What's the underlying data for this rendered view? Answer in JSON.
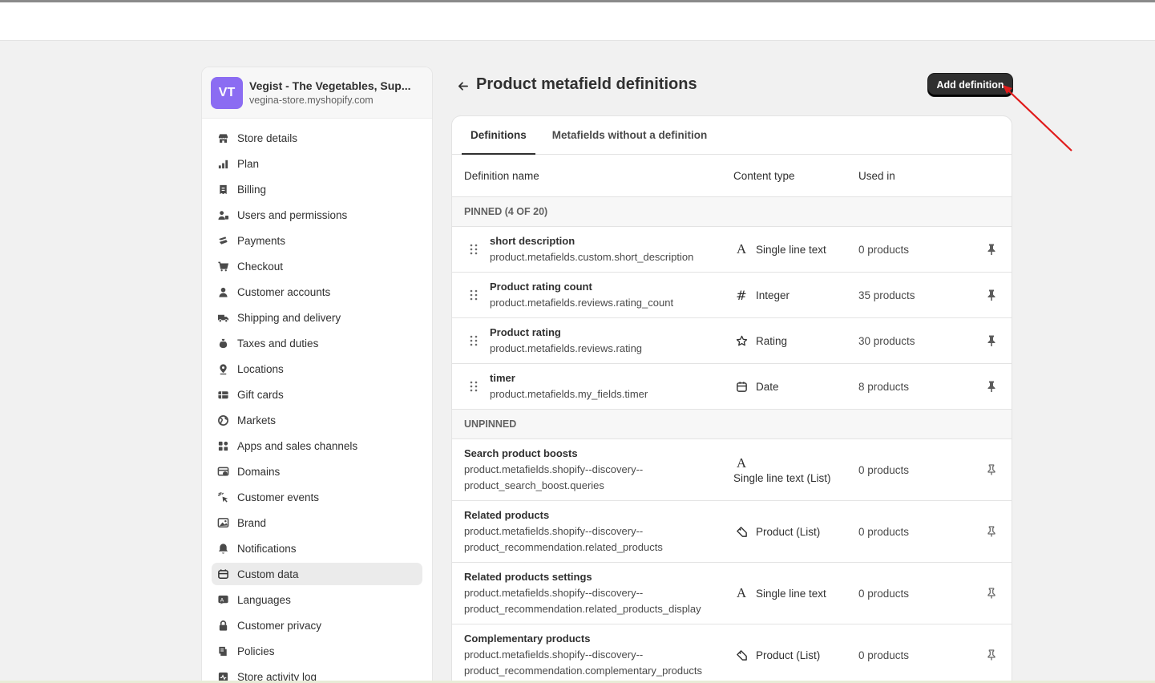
{
  "store": {
    "initials": "VT",
    "name": "Vegist - The Vegetables, Sup...",
    "domain": "vegina-store.myshopify.com"
  },
  "sidebar": {
    "items": [
      {
        "label": "Store details",
        "icon": "store-icon"
      },
      {
        "label": "Plan",
        "icon": "plan-icon"
      },
      {
        "label": "Billing",
        "icon": "billing-icon"
      },
      {
        "label": "Users and permissions",
        "icon": "users-icon"
      },
      {
        "label": "Payments",
        "icon": "payments-icon"
      },
      {
        "label": "Checkout",
        "icon": "cart-icon"
      },
      {
        "label": "Customer accounts",
        "icon": "person-icon"
      },
      {
        "label": "Shipping and delivery",
        "icon": "truck-icon"
      },
      {
        "label": "Taxes and duties",
        "icon": "tax-icon"
      },
      {
        "label": "Locations",
        "icon": "location-icon"
      },
      {
        "label": "Gift cards",
        "icon": "gift-card-icon"
      },
      {
        "label": "Markets",
        "icon": "globe-icon"
      },
      {
        "label": "Apps and sales channels",
        "icon": "apps-icon"
      },
      {
        "label": "Domains",
        "icon": "domain-icon"
      },
      {
        "label": "Customer events",
        "icon": "cursor-icon"
      },
      {
        "label": "Brand",
        "icon": "brand-icon"
      },
      {
        "label": "Notifications",
        "icon": "bell-icon"
      },
      {
        "label": "Custom data",
        "icon": "database-icon",
        "active": true
      },
      {
        "label": "Languages",
        "icon": "language-icon"
      },
      {
        "label": "Customer privacy",
        "icon": "lock-icon"
      },
      {
        "label": "Policies",
        "icon": "policy-icon"
      },
      {
        "label": "Store activity log",
        "icon": "activity-icon"
      }
    ]
  },
  "header": {
    "title": "Product metafield definitions",
    "add_button": "Add definition"
  },
  "tabs": [
    {
      "label": "Definitions",
      "active": true
    },
    {
      "label": "Metafields without a definition",
      "active": false
    }
  ],
  "table": {
    "columns": {
      "name": "Definition name",
      "type": "Content type",
      "used": "Used in"
    },
    "pinned_label": "PINNED (4 OF 20)",
    "unpinned_label": "UNPINNED",
    "pinned": [
      {
        "title": "short description",
        "key": "product.metafields.custom.short_description",
        "type": "Single line text",
        "type_icon": "A",
        "used": "0 products"
      },
      {
        "title": "Product rating count",
        "key": "product.metafields.reviews.rating_count",
        "type": "Integer",
        "type_icon": "#",
        "used": "35 products"
      },
      {
        "title": "Product rating",
        "key": "product.metafields.reviews.rating",
        "type": "Rating",
        "type_icon": "☆",
        "used": "30 products"
      },
      {
        "title": "timer",
        "key": "product.metafields.my_fields.timer",
        "type": "Date",
        "type_icon": "date",
        "used": "8 products"
      }
    ],
    "unpinned": [
      {
        "title": "Search product boosts",
        "key1": "product.metafields.shopify--discovery--",
        "key2": "product_search_boost.queries",
        "type": "Single line text (List)",
        "type_icon": "A",
        "used": "0 products"
      },
      {
        "title": "Related products",
        "key1": "product.metafields.shopify--discovery--",
        "key2": "product_recommendation.related_products",
        "type": "Product (List)",
        "type_icon": "tag",
        "used": "0 products"
      },
      {
        "title": "Related products settings",
        "key1": "product.metafields.shopify--discovery--",
        "key2": "product_recommendation.related_products_display",
        "type": "Single line text",
        "type_icon": "A",
        "used": "0 products"
      },
      {
        "title": "Complementary products",
        "key1": "product.metafields.shopify--discovery--",
        "key2": "product_recommendation.complementary_products",
        "type": "Product (List)",
        "type_icon": "tag",
        "used": "0 products"
      }
    ]
  },
  "colors": {
    "accent_button": "#303030",
    "avatar": "#8b6cf2",
    "annotation_arrow": "#e01b1b"
  }
}
